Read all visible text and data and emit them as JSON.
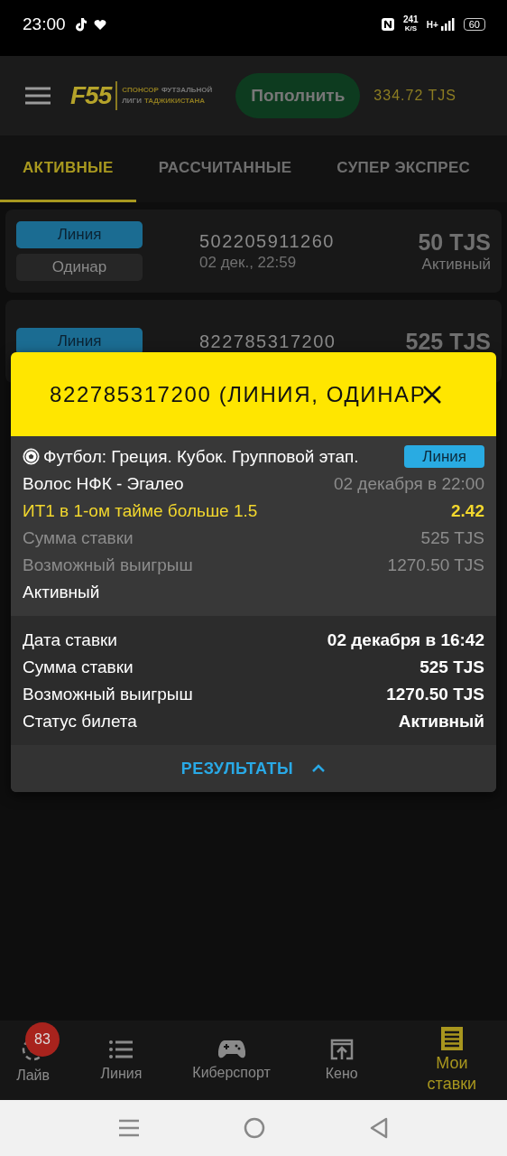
{
  "status_bar": {
    "time": "23:00",
    "net_speed": "241",
    "net_unit": "K/S",
    "network": "H+",
    "battery": "60"
  },
  "header": {
    "logo": "F55",
    "tagline": [
      [
        {
          "text": "СПОНСОР",
          "highlight": true
        },
        {
          "text": "ФУТЗАЛЬНОЙ",
          "highlight": false
        }
      ],
      [
        {
          "text": "ЛИГИ",
          "highlight": false
        },
        {
          "text": "ТАДЖИКИСТАНА",
          "highlight": true
        }
      ]
    ],
    "deposit_button": "Пополнить",
    "balance": "334.72 TJS"
  },
  "tabs": [
    {
      "label": "АКТИВНЫЕ",
      "selected": true
    },
    {
      "label": "РАССЧИТАННЫЕ",
      "selected": false
    },
    {
      "label": "СУПЕР ЭКСПРЕС",
      "selected": false
    }
  ],
  "bets": [
    {
      "type_chip": "Линия",
      "kind_chip": "Одинар",
      "number": "502205911260",
      "date": "02 дек., 22:59",
      "amount": "50 TJS",
      "status": "Активный"
    },
    {
      "type_chip": "Линия",
      "number": "822785317200",
      "amount": "525 TJS"
    }
  ],
  "modal": {
    "title": "822785317200 (ЛИНИЯ, ОДИНАР",
    "event": {
      "sport": "Футбол: Греция. Кубок. Групповой этап.",
      "badge": "Линия",
      "match": "Волос НФК - Эгалео",
      "start": "02 декабря в 22:00",
      "pick": "ИТ1 в 1-ом тайме больше 1.5",
      "odds": "2.42",
      "rows": [
        {
          "label": "Сумма ставки",
          "value": "525 TJS"
        },
        {
          "label": "Возможный выигрыш",
          "value": "1270.50 TJS"
        }
      ],
      "status": "Активный"
    },
    "summary": [
      {
        "label": "Дата ставки",
        "value": "02 декабря в 16:42"
      },
      {
        "label": "Сумма ставки",
        "value": "525 TJS"
      },
      {
        "label": "Возможный выигрыш",
        "value": "1270.50 TJS"
      },
      {
        "label": "Статус билета",
        "value": "Активный"
      }
    ],
    "results_button": "РЕЗУЛЬТАТЫ",
    "results_expanded": true
  },
  "bottom_nav": [
    {
      "label": "Лайв",
      "kind": "live",
      "badge": "83",
      "selected": false
    },
    {
      "label": "Линия",
      "kind": "list",
      "selected": false
    },
    {
      "label": "Киберспорт",
      "kind": "gamepad",
      "selected": false
    },
    {
      "label": "Кено",
      "kind": "keno",
      "selected": false
    },
    {
      "label": "Мои ставки",
      "kind": "ticket",
      "selected": true
    }
  ]
}
